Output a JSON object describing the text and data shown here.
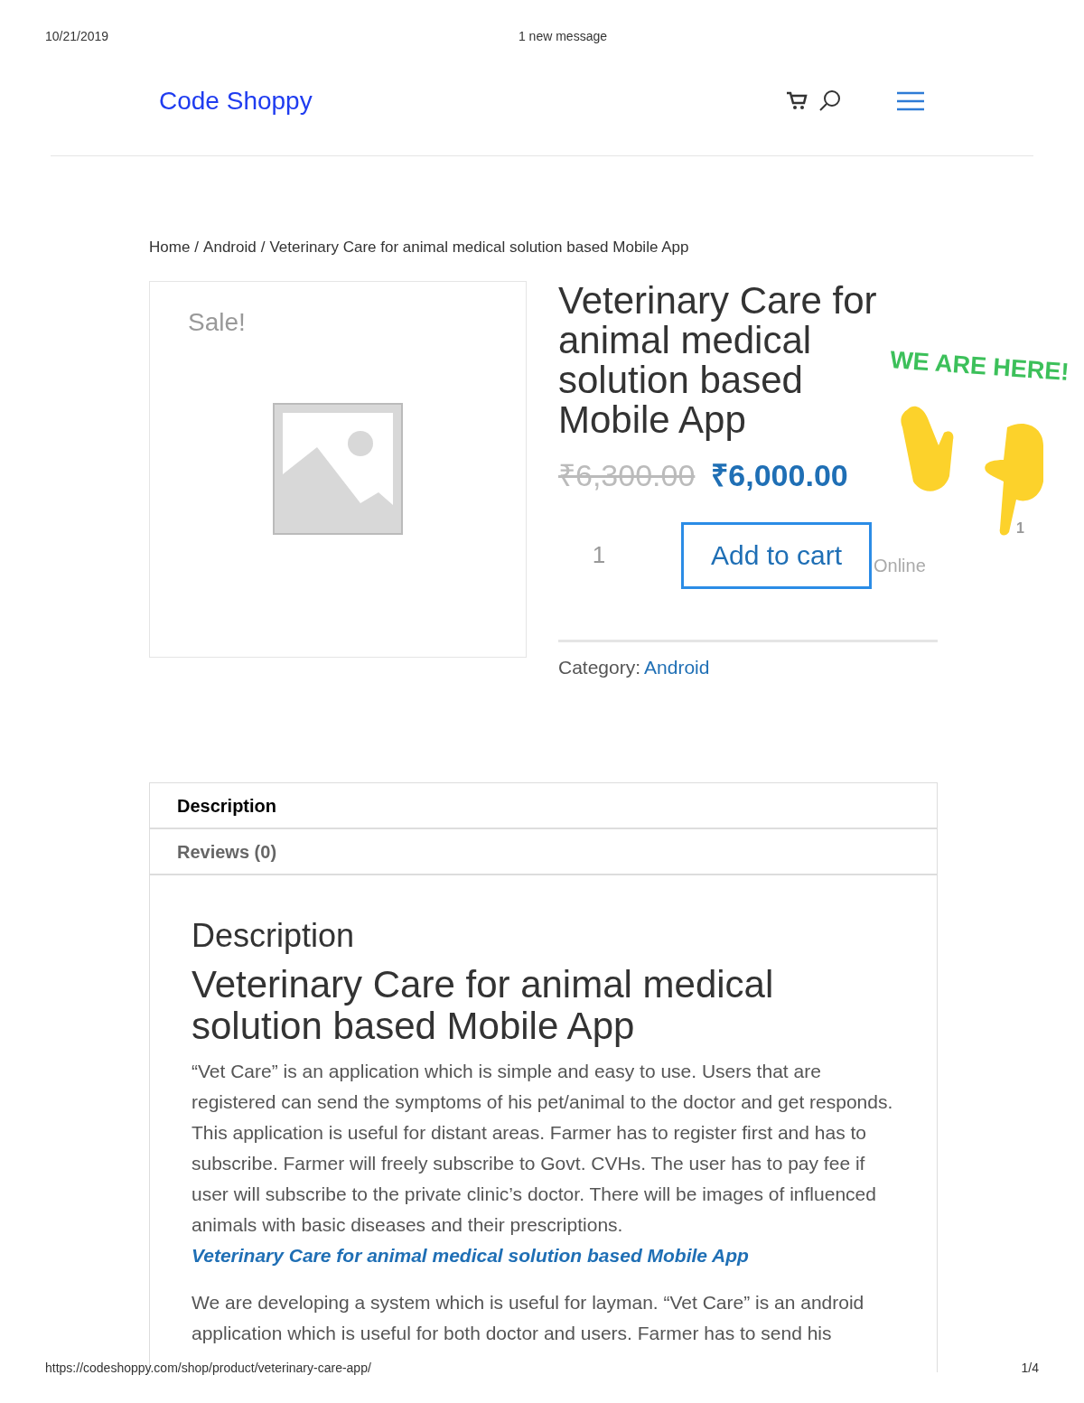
{
  "print_header": {
    "date": "10/21/2019",
    "title": "1 new message"
  },
  "site": {
    "logo": "Code Shoppy"
  },
  "breadcrumb": {
    "separator": "/",
    "items": [
      "Home",
      "Android",
      "Veterinary Care for animal medical solution based Mobile App"
    ]
  },
  "product": {
    "sale_badge": "Sale!",
    "title": "Veterinary Care for animal medical solution based Mobile App",
    "old_price": "₹6,300.00",
    "price": "₹6,000.00",
    "quantity": "1",
    "add_to_cart": "Add to cart",
    "category_label": "Category:",
    "category": "Android"
  },
  "chat_widget": {
    "text": "WE ARE HERE!",
    "count": "1",
    "status": "Online"
  },
  "tabs": [
    {
      "label": "Description",
      "selected": true
    },
    {
      "label": "Reviews (0)",
      "selected": false
    }
  ],
  "description": {
    "heading": "Description",
    "title": "Veterinary Care for animal medical solution based Mobile App",
    "paragraphs": [
      "“Vet Care” is an application which is simple and easy to use. Users that are registered can send the symptoms of his pet/animal to the doctor and get responds. This application is useful for distant areas. Farmer has to register first and has to subscribe. Farmer will freely subscribe to Govt. CVHs. The user has to pay fee if user will subscribe to the private clinic’s doctor. There will be images of influenced animals with basic diseases and their prescriptions.",
      "We are developing a system which is useful for layman. “Vet Care” is an android application which is useful for both doctor and users. Farmer has to send his"
    ],
    "link": "Veterinary Care for animal medical solution based Mobile App"
  },
  "print_footer": {
    "url": "https://codeshoppy.com/shop/product/veterinary-care-app/",
    "page": "1/4"
  }
}
